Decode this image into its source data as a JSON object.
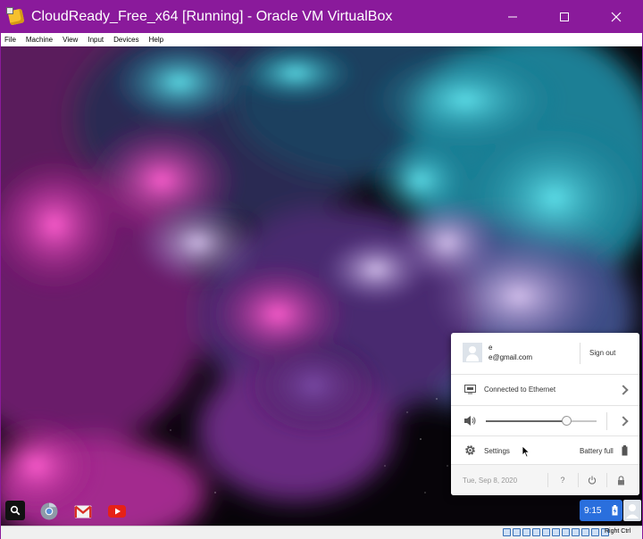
{
  "window": {
    "title": "CloudReady_Free_x64 [Running] - Oracle VM VirtualBox",
    "controls": {
      "minimize_icon": "minimize-icon",
      "maximize_icon": "maximize-icon",
      "close_icon": "close-icon"
    }
  },
  "menubar": {
    "items": [
      {
        "label": "File"
      },
      {
        "label": "Machine"
      },
      {
        "label": "View"
      },
      {
        "label": "Input"
      },
      {
        "label": "Devices"
      },
      {
        "label": "Help"
      }
    ]
  },
  "tray": {
    "user_name": "e",
    "user_email": "e@gmail.com",
    "sign_out": "Sign out",
    "network_label": "Connected to Ethernet",
    "volume_level": 0.73,
    "settings_label": "Settings",
    "battery_label": "Battery full",
    "date": "Tue, Sep 8, 2020",
    "help_label": "?"
  },
  "shelf": {
    "apps": [
      "search-icon",
      "chrome-icon",
      "gmail-icon",
      "youtube-icon"
    ],
    "time": "9:15"
  },
  "hoststatus": {
    "host_key": "Right Ctrl"
  },
  "colors": {
    "titlebar": "#8a1a9b",
    "status_area": "#2a6fdd"
  }
}
